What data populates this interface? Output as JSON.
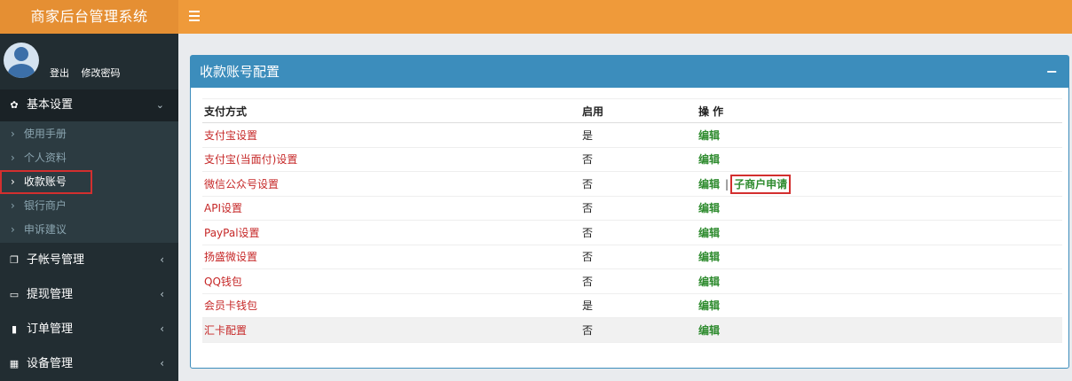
{
  "brand": "商家后台管理系统",
  "user": {
    "logout": "登出",
    "change_password": "修改密码"
  },
  "sidebar": {
    "basic": {
      "label": "基本设置",
      "items": [
        "使用手册",
        "个人资料",
        "收款账号",
        "银行商户",
        "申诉建议"
      ]
    },
    "groups": [
      {
        "label": "子帐号管理",
        "icon": "copy-icon"
      },
      {
        "label": "提现管理",
        "icon": "credit-card-icon"
      },
      {
        "label": "订单管理",
        "icon": "file-icon"
      },
      {
        "label": "设备管理",
        "icon": "grid-icon"
      }
    ]
  },
  "panel": {
    "title": "收款账号配置",
    "columns": [
      "支付方式",
      "启用",
      "操 作"
    ],
    "rows": [
      {
        "name": "支付宝设置",
        "enabled": "是",
        "edit": "编辑"
      },
      {
        "name": "支付宝(当面付)设置",
        "enabled": "否",
        "edit": "编辑"
      },
      {
        "name": "微信公众号设置",
        "enabled": "否",
        "edit": "编辑",
        "extra": "子商户申请"
      },
      {
        "name": "API设置",
        "enabled": "否",
        "edit": "编辑"
      },
      {
        "name": "PayPal设置",
        "enabled": "否",
        "edit": "编辑"
      },
      {
        "name": "扬盛微设置",
        "enabled": "否",
        "edit": "编辑"
      },
      {
        "name": "QQ钱包",
        "enabled": "否",
        "edit": "编辑"
      },
      {
        "name": "会员卡钱包",
        "enabled": "是",
        "edit": "编辑"
      },
      {
        "name": "汇卡配置",
        "enabled": "否",
        "edit": "编辑"
      }
    ]
  },
  "colors": {
    "topbar": "#ef9a3a",
    "sidebar": "#222d32",
    "panel_header": "#3c8dbc",
    "link_red": "#c62828",
    "action_green": "#2e8b2e"
  }
}
